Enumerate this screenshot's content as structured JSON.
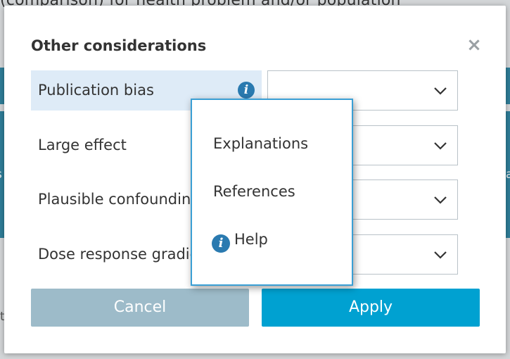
{
  "background": {
    "header_text": "(comparison) for health problem and/or population",
    "left_fragment": "s",
    "right_fragment": "a",
    "bottom_fragment": "t"
  },
  "dialog": {
    "title": "Other considerations",
    "close_icon": "×",
    "rows": [
      {
        "label": "Publication bias",
        "value": ""
      },
      {
        "label": "Large effect",
        "value": ""
      },
      {
        "label": "Plausible confounding",
        "value": ""
      },
      {
        "label": "Dose response gradient",
        "value": ""
      }
    ],
    "info_icon_glyph": "i",
    "cancel_label": "Cancel",
    "apply_label": "Apply"
  },
  "popup": {
    "items": [
      {
        "label": "Explanations"
      },
      {
        "label": "References"
      },
      {
        "label": "Help",
        "icon": "info-icon"
      }
    ]
  },
  "colors": {
    "accent": "#00a1d1",
    "cancel": "#9dbbc9",
    "selected_row": "#deebf7",
    "popup_border": "#3a9fd5"
  }
}
